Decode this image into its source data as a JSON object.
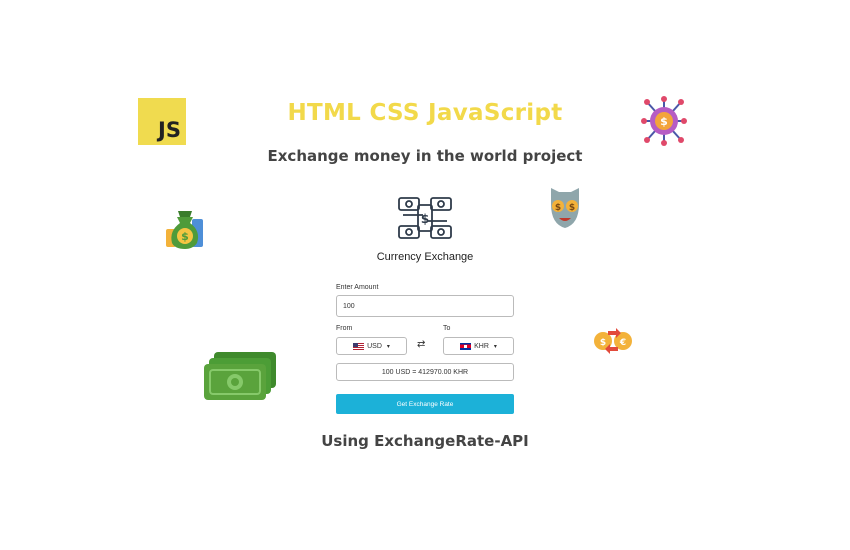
{
  "header": {
    "title": "HTML CSS JavaScript",
    "subtitle": "Exchange money in the world project"
  },
  "js_logo_text": "JS",
  "app": {
    "title": "Currency Exchange",
    "amount_label": "Enter Amount",
    "amount_value": "100",
    "from_label": "From",
    "to_label": "To",
    "from_currency": "USD",
    "to_currency": "KHR",
    "swap_symbol": "⇄",
    "result_text": "100 USD = 412970.00 KHR",
    "button_label": "Get Exchange Rate"
  },
  "footer": "Using ExchangeRate-API",
  "colors": {
    "title": "#f2d94a",
    "button": "#1cb1d8",
    "js_logo": "#f0db4f",
    "money_green": "#5aa33c"
  },
  "icons": [
    "js-logo",
    "money-network-icon",
    "money-bag-icon",
    "money-face-icon",
    "cash-stack-icon",
    "coin-exchange-icon",
    "currency-exchange-logo",
    "chevron-down-icon",
    "swap-icon"
  ]
}
